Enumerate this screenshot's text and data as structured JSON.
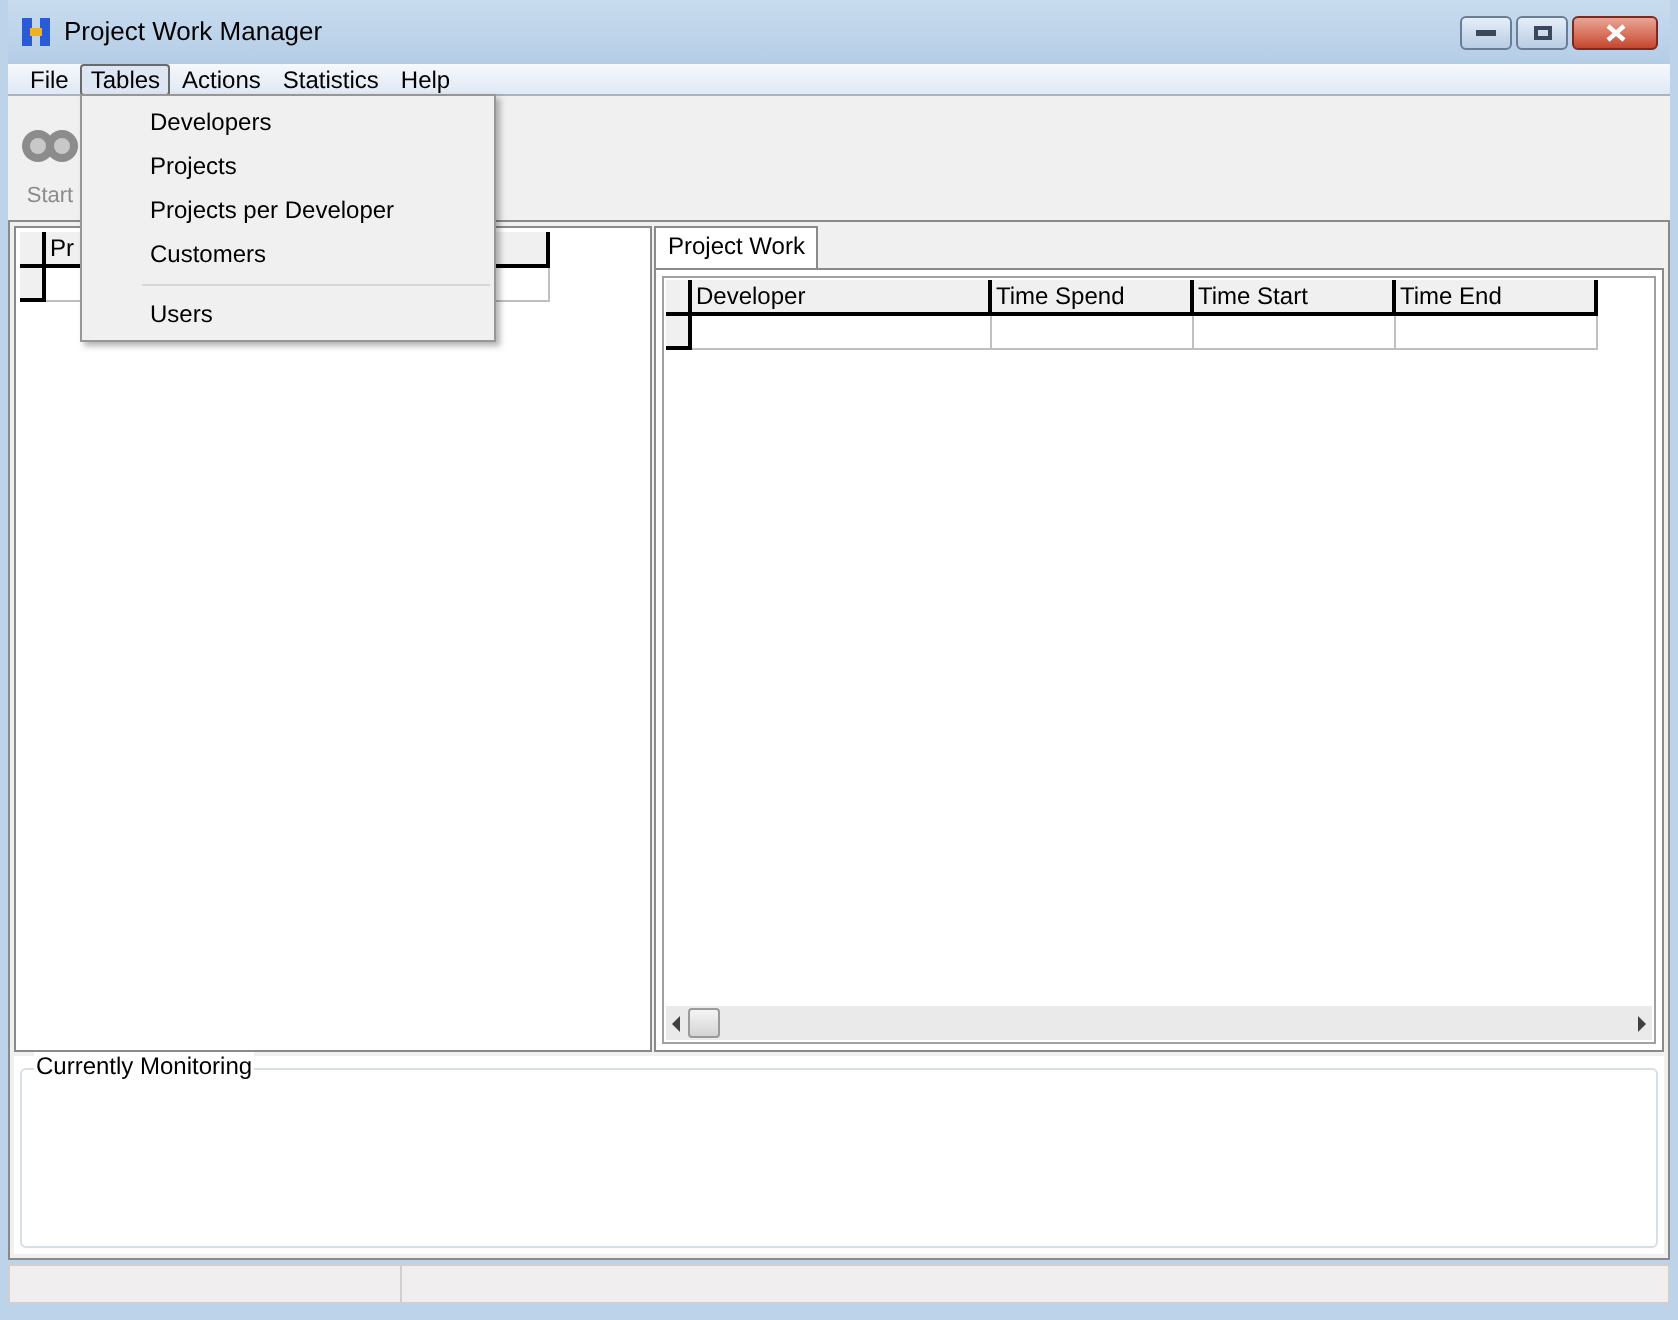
{
  "window": {
    "title": "Project Work Manager"
  },
  "menu_bar": [
    {
      "label": "File",
      "selected": false
    },
    {
      "label": "Tables",
      "selected": true
    },
    {
      "label": "Actions",
      "selected": false
    },
    {
      "label": "Statistics",
      "selected": false
    },
    {
      "label": "Help",
      "selected": false
    }
  ],
  "open_menu": {
    "items": [
      {
        "kind": "item",
        "label": "Developers"
      },
      {
        "kind": "item",
        "label": "Projects"
      },
      {
        "kind": "item",
        "label": "Projects per Developer"
      },
      {
        "kind": "item",
        "label": "Customers"
      },
      {
        "kind": "separator"
      },
      {
        "kind": "item",
        "label": "Users"
      }
    ]
  },
  "toolbar": {
    "button": "Start"
  },
  "left_grid": {
    "columns": [
      "Pr"
    ]
  },
  "tabs": [
    {
      "label": "Project Work",
      "selected": true
    }
  ],
  "work_grid": {
    "columns": [
      "Developer",
      "Time Spend",
      "Time Start",
      "Time End"
    ]
  },
  "group": {
    "title": "Currently Monitoring"
  }
}
